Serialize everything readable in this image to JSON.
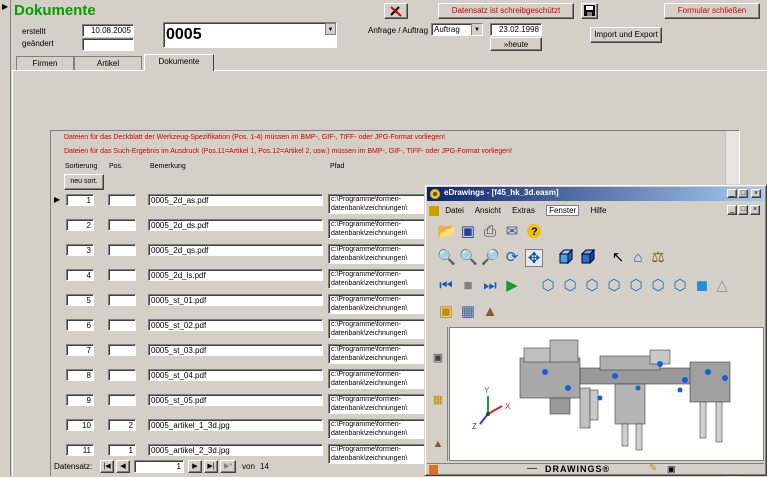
{
  "form": {
    "title": "Dokumente",
    "erstellt_label": "erstellt",
    "geaendert_label": "geändert",
    "erstellt_value": "10.08.2005",
    "geaendert_value": "",
    "doc_number": "0005",
    "anfrage_label": "Anfrage / Auftrag",
    "anfrage_value": "Auftrag",
    "date_value": "23.02.1998",
    "heute_label": "»heute",
    "readonly_label": "Datensatz ist schreibgeschützt",
    "close_label": "Formular schließen",
    "import_export_label": "Import und Export"
  },
  "tabs": [
    "Firmen",
    "Artikel",
    "Dokumente"
  ],
  "notes": [
    "Dateien für das Deckblatt der Werkzeug-Spezifikation (Pos. 1-4) müssen im BMP-, GIF-, TIFF- oder JPG-Format vorliegen!",
    "Dateien für das Such-Ergebnis im Ausdruck (Pos.11=Artikel 1, Pos.12=Artikel 2, usw.) müssen im BMP-, GIF-, TIFF- oder JPG-Format vorliegen!"
  ],
  "grid": {
    "headers": {
      "sortierung": "Sortierung",
      "pos": "Pos.",
      "bemerkung": "Bemerkung",
      "pfad": "Pfad"
    },
    "new_sort_label": "neu sort.",
    "rows": [
      {
        "sort": "1",
        "pos": "",
        "bem": "0005_2d_as.pdf",
        "pfad1": "c:\\Programme\\formen-",
        "pfad2": "datenbank\\zeichnungen\\"
      },
      {
        "sort": "2",
        "pos": "",
        "bem": "0005_2d_ds.pdf",
        "pfad1": "c:\\Programme\\formen-",
        "pfad2": "datenbank\\zeichnungen\\"
      },
      {
        "sort": "3",
        "pos": "",
        "bem": "0005_2d_qs.pdf",
        "pfad1": "c:\\Programme\\formen-",
        "pfad2": "datenbank\\zeichnungen\\"
      },
      {
        "sort": "4",
        "pos": "",
        "bem": "0005_2d_ls.pdf",
        "pfad1": "c:\\Programme\\formen-",
        "pfad2": "datenbank\\zeichnungen\\"
      },
      {
        "sort": "5",
        "pos": "",
        "bem": "0005_st_01.pdf",
        "pfad1": "c:\\Programme\\formen-",
        "pfad2": "datenbank\\zeichnungen\\"
      },
      {
        "sort": "6",
        "pos": "",
        "bem": "0005_st_02.pdf",
        "pfad1": "c:\\Programme\\formen-",
        "pfad2": "datenbank\\zeichnungen\\"
      },
      {
        "sort": "7",
        "pos": "",
        "bem": "0005_st_03.pdf",
        "pfad1": "c:\\Programme\\formen-",
        "pfad2": "datenbank\\zeichnungen\\"
      },
      {
        "sort": "8",
        "pos": "",
        "bem": "0005_st_04.pdf",
        "pfad1": "c:\\Programme\\formen-",
        "pfad2": "datenbank\\zeichnungen\\"
      },
      {
        "sort": "9",
        "pos": "",
        "bem": "0005_st_05.pdf",
        "pfad1": "c:\\Programme\\formen-",
        "pfad2": "datenbank\\zeichnungen\\"
      },
      {
        "sort": "10",
        "pos": "2",
        "bem": "0005_artikel_1_3d.jpg",
        "pfad1": "c:\\Programme\\formen-",
        "pfad2": "datenbank\\zeichnungen\\"
      },
      {
        "sort": "11",
        "pos": "1",
        "bem": "0005_artikel_2_3d.jpg",
        "pfad1": "c:\\Programme\\formen-",
        "pfad2": "datenbank\\zeichnungen\\"
      }
    ]
  },
  "navigator": {
    "label": "Datensatz:",
    "current": "1",
    "of_label": "von",
    "total": "14"
  },
  "edrawings": {
    "title": "eDrawings - [f45_hk_3d.easm]",
    "menu": [
      "Datei",
      "Ansicht",
      "Extras",
      "Fenster",
      "Hilfe"
    ],
    "brand": "DRAWINGS®",
    "axes": {
      "x": "X",
      "y": "Y",
      "z": "Z"
    }
  },
  "colors": {
    "title_green": "#00a000",
    "warning_red": "#d00000",
    "titlebar_blue": "#0a246a"
  }
}
